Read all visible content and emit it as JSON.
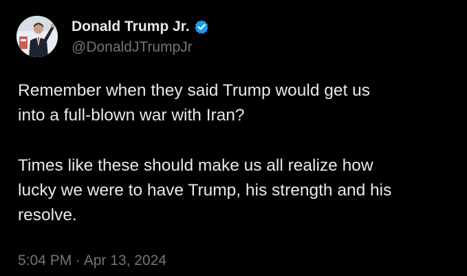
{
  "author": {
    "display_name": "Donald Trump Jr.",
    "handle": "@DonaldJTrumpJr",
    "verified_icon": "verified-badge-icon",
    "verified_color": "#1d9bf0",
    "avatar_icon": "profile-photo"
  },
  "tweet": {
    "paragraphs": [
      "Remember when they said Trump would get us\ninto a full-blown war with Iran?",
      "Times like these should make us all realize how\nlucky we were to have Trump, his strength and his\nresolve."
    ],
    "time": "5:04 PM",
    "separator": "·",
    "date": "Apr 13, 2024"
  },
  "colors": {
    "background": "#000000",
    "primary_text": "#e7e9ea",
    "secondary_text": "#71767b"
  }
}
